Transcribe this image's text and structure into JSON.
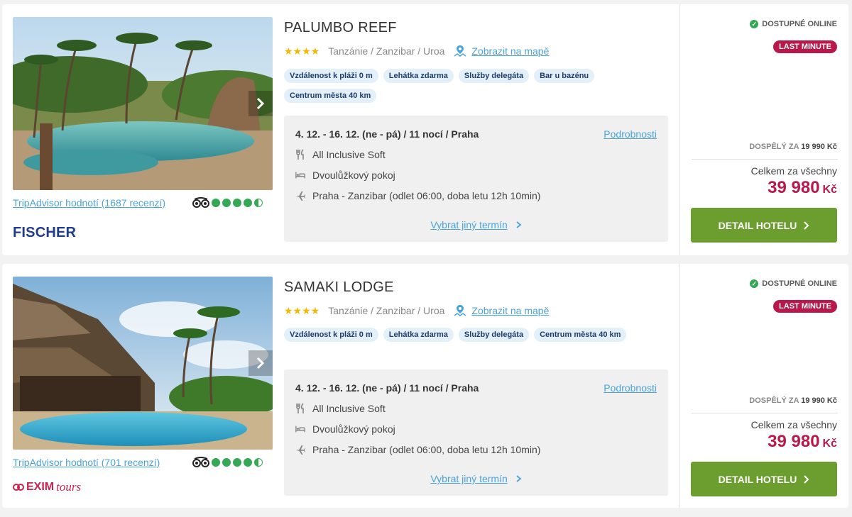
{
  "hotels": [
    {
      "name": "PALUMBO REEF",
      "location": "Tanzánie / Zanzibar / Uroa",
      "map_link": "Zobrazit na mapě",
      "stars": 4,
      "tags": [
        "Vzdálenost k pláži 0 m",
        "Lehátka zdarma",
        "Služby delegáta",
        "Bar u bazénu",
        "Centrum města 40 km"
      ],
      "term": "4. 12. - 16. 12. (ne - pá) / 11 nocí / Praha",
      "details_link": "Podrobnosti",
      "board": "All Inclusive Soft",
      "room": "Dvoulůžkový pokoj",
      "flight": "Praha - Zanzibar (odlet 06:00, doba letu 12h 10min)",
      "other_term": "Vybrat jiný termín",
      "tripadvisor": "TripAdvisor hodnotí (1687 recenzí)",
      "tripadvisor_rating": 4.5,
      "operator": "FISCHER",
      "online": "DOSTUPNÉ ONLINE",
      "badge": "LAST MINUTE",
      "per_adult_label": "DOSPĚLÝ ZA",
      "per_adult_price": "19 990 Kč",
      "total_label": "Celkem za všechny",
      "total_price": "39 980",
      "currency": "Kč",
      "button": "DETAIL HOTELU"
    },
    {
      "name": "SAMAKI LODGE",
      "location": "Tanzánie / Zanzibar / Uroa",
      "map_link": "Zobrazit na mapě",
      "stars": 4,
      "tags": [
        "Vzdálenost k pláži 0 m",
        "Lehátka zdarma",
        "Služby delegáta",
        "Centrum města 40 km"
      ],
      "term": "4. 12. - 16. 12. (ne - pá) / 11 nocí / Praha",
      "details_link": "Podrobnosti",
      "board": "All Inclusive Soft",
      "room": "Dvoulůžkový pokoj",
      "flight": "Praha - Zanzibar (odlet 06:00, doba letu 12h 10min)",
      "other_term": "Vybrat jiný termín",
      "tripadvisor": "TripAdvisor hodnotí (701 recenzí)",
      "tripadvisor_rating": 4.5,
      "operator_main": "EXIM",
      "operator_sub": "tours",
      "online": "DOSTUPNÉ ONLINE",
      "badge": "LAST MINUTE",
      "per_adult_label": "DOSPĚLÝ ZA",
      "per_adult_price": "19 990 Kč",
      "total_label": "Celkem za všechny",
      "total_price": "39 980",
      "currency": "Kč",
      "button": "DETAIL HOTELU"
    }
  ],
  "colors": {
    "accent": "#4aa3d9",
    "price": "#b8184a",
    "button": "#6b9e2e",
    "stars": "#f5b800",
    "tag_bg": "#e3f0fa"
  },
  "icons": [
    "map-pin-icon",
    "cutlery-icon",
    "bed-icon",
    "plane-icon",
    "chevron-right-icon",
    "check-circle-icon",
    "tripadvisor-owl-icon"
  ]
}
